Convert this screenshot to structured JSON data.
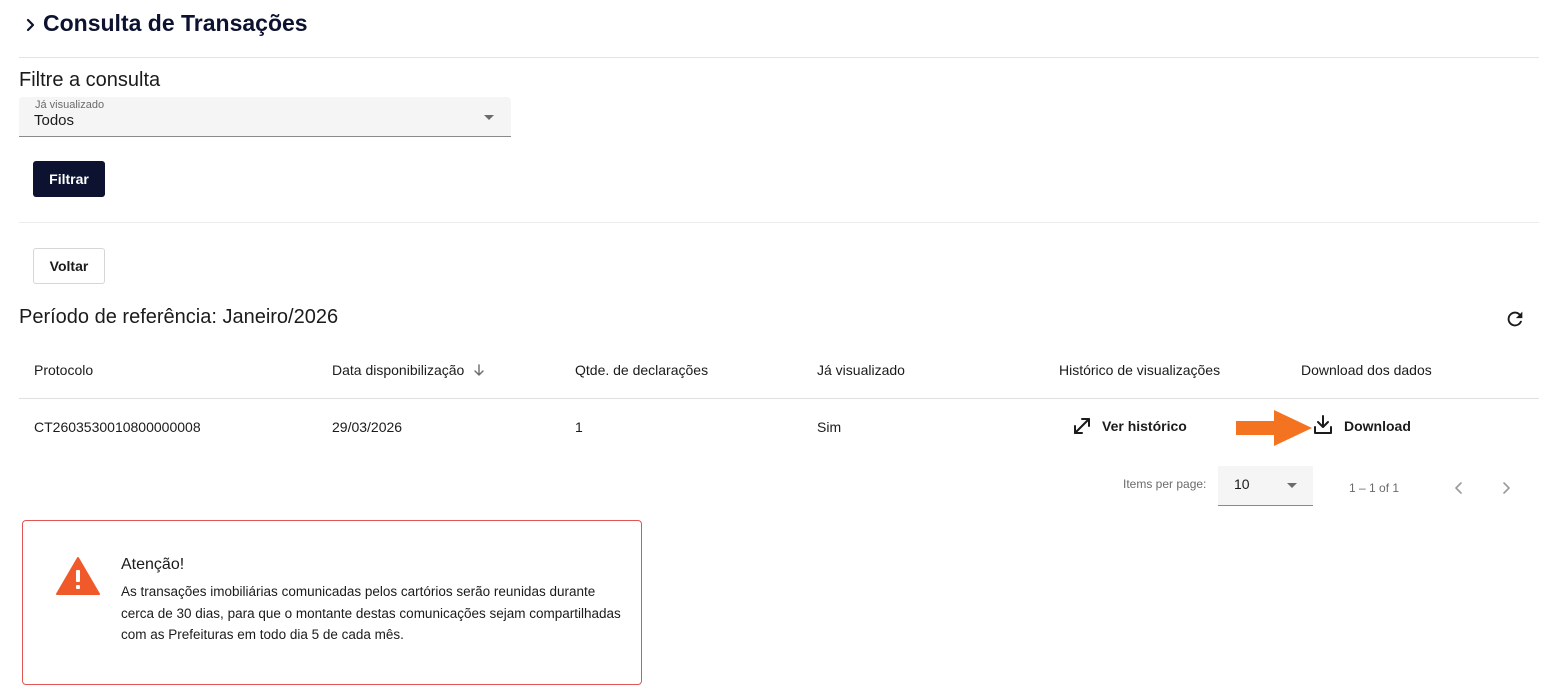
{
  "header": {
    "title": "Consulta de Transações"
  },
  "filter": {
    "section_title": "Filtre a consulta",
    "viewed_select": {
      "label": "Já visualizado",
      "value": "Todos"
    },
    "filter_button": "Filtrar",
    "back_button": "Voltar"
  },
  "period": {
    "title": "Período de referência: Janeiro/2026"
  },
  "table": {
    "columns": [
      "Protocolo",
      "Data disponibilização",
      "Qtde. de declarações",
      "Já visualizado",
      "Histórico de visualizações",
      "Download dos dados"
    ],
    "sort": {
      "column": "Data disponibilização",
      "direction": "descending"
    },
    "rows": [
      {
        "protocolo": "CT2603530010800000008",
        "data": "29/03/2026",
        "qtde": "1",
        "visualizado": "Sim",
        "historico_label": "Ver histórico",
        "download_label": "Download"
      }
    ]
  },
  "paginator": {
    "items_per_page_label": "Items per page:",
    "page_size": "10",
    "range": "1 – 1 of 1"
  },
  "alert": {
    "title": "Atenção!",
    "message": "As transações imobiliárias comunicadas pelos cartórios serão reunidas durante cerca de 30 dias, para que o montante destas comunicações sejam compartilhadas com as Prefeituras em todo dia 5 de cada mês."
  },
  "colors": {
    "primary": "#0c1230",
    "annotation_arrow": "#f37321",
    "alert_border": "#e25555",
    "alert_icon": "#f05a2a"
  },
  "icons": {
    "title_chevron": "chevron-right-icon",
    "select_caret": "arrow-drop-down-icon",
    "refresh": "refresh-icon",
    "sort": "arrow-down-icon",
    "history": "expand-arrows-icon",
    "download": "download-icon",
    "prev_page": "chevron-left-icon",
    "next_page": "chevron-right-icon",
    "warning": "warning-triangle-icon"
  }
}
